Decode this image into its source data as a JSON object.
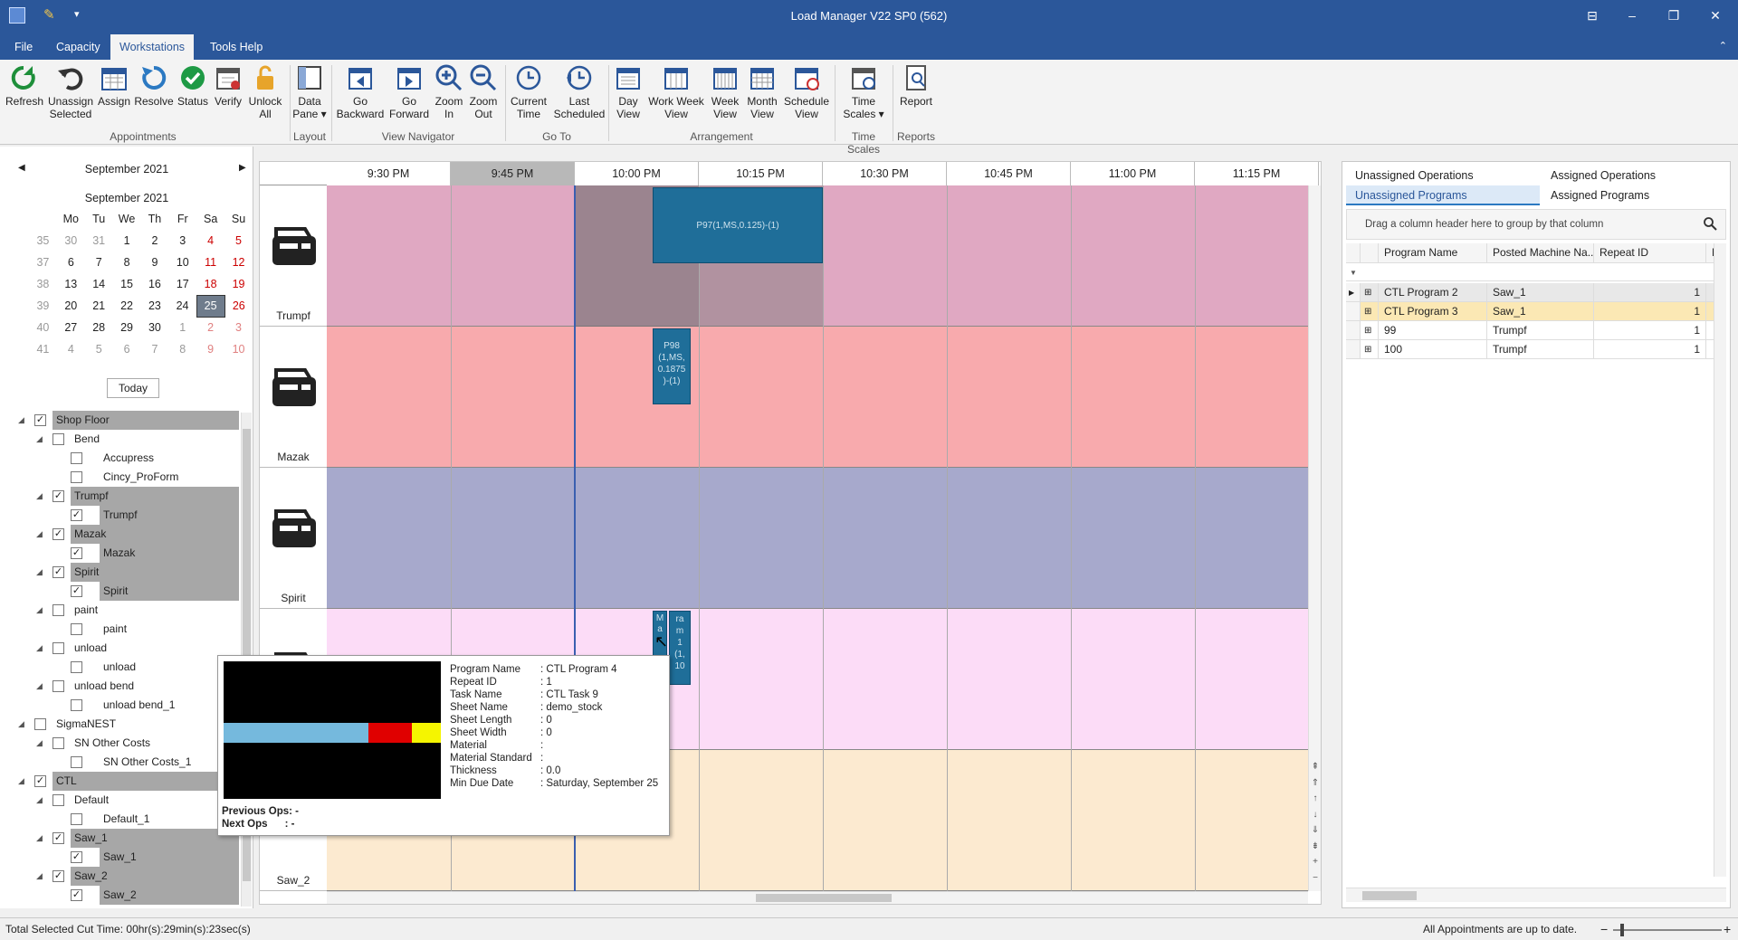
{
  "window": {
    "title": "Load Manager V22 SP0 (562)"
  },
  "menu": {
    "file": "File",
    "capacity": "Capacity",
    "workstations": "Workstations",
    "tools_help": "Tools Help"
  },
  "ribbon": {
    "refresh": "Refresh",
    "unassign": "Unassign",
    "unassign2": "Selected",
    "assign": "Assign",
    "resolve": "Resolve",
    "status": "Status",
    "verify": "Verify",
    "unlock": "Unlock",
    "unlock2": "All",
    "data": "Data",
    "pane": "Pane ▾",
    "go_backward": "Go",
    "go_backward2": "Backward",
    "go_forward": "Go",
    "go_forward2": "Forward",
    "zoom_in": "Zoom",
    "zoom_in2": "In",
    "zoom_out": "Zoom",
    "zoom_out2": "Out",
    "current_time": "Current",
    "current_time2": "Time",
    "last_scheduled": "Last",
    "last_scheduled2": "Scheduled",
    "day_view": "Day",
    "day_view2": "View",
    "work_week": "Work Week",
    "work_week2": "View",
    "week_view": "Week",
    "week_view2": "View",
    "month_view": "Month",
    "month_view2": "View",
    "schedule_view": "Schedule",
    "schedule_view2": "View",
    "time_scales": "Time",
    "time_scales2": "Scales ▾",
    "report": "Report",
    "groups": {
      "appointments": "Appointments",
      "layout": "Layout",
      "view_navigator": "View Navigator",
      "go_to": "Go To",
      "arrangement": "Arrangement",
      "time_scales": "Time Scales",
      "reports": "Reports"
    }
  },
  "calendar": {
    "header": "September 2021",
    "month_title": "September 2021",
    "days": [
      "Mo",
      "Tu",
      "We",
      "Th",
      "Fr",
      "Sa",
      "Su"
    ],
    "weeks": [
      {
        "wk": "35",
        "d": [
          "30",
          "31",
          "1",
          "2",
          "3",
          "4",
          "5"
        ]
      },
      {
        "wk": "37",
        "d": [
          "6",
          "7",
          "8",
          "9",
          "10",
          "11",
          "12"
        ]
      },
      {
        "wk": "38",
        "d": [
          "13",
          "14",
          "15",
          "16",
          "17",
          "18",
          "19"
        ]
      },
      {
        "wk": "39",
        "d": [
          "20",
          "21",
          "22",
          "23",
          "24",
          "25",
          "26"
        ]
      },
      {
        "wk": "40",
        "d": [
          "27",
          "28",
          "29",
          "30",
          "1",
          "2",
          "3"
        ]
      },
      {
        "wk": "41",
        "d": [
          "4",
          "5",
          "6",
          "7",
          "8",
          "9",
          "10"
        ]
      }
    ],
    "today": "Today"
  },
  "tree": [
    {
      "label": "Shop Floor",
      "level": 0,
      "checked": true,
      "hl": true,
      "exp": true
    },
    {
      "label": "Bend",
      "level": 1,
      "checked": false,
      "hl": false,
      "exp": true
    },
    {
      "label": "Accupress",
      "level": 2,
      "checked": false,
      "hl": false
    },
    {
      "label": "Cincy_ProForm",
      "level": 2,
      "checked": false,
      "hl": false
    },
    {
      "label": "Trumpf",
      "level": 1,
      "checked": true,
      "hl": true,
      "exp": true
    },
    {
      "label": "Trumpf",
      "level": 2,
      "checked": true,
      "hl": true
    },
    {
      "label": "Mazak",
      "level": 1,
      "checked": true,
      "hl": true,
      "exp": true
    },
    {
      "label": "Mazak",
      "level": 2,
      "checked": true,
      "hl": true
    },
    {
      "label": "Spirit",
      "level": 1,
      "checked": true,
      "hl": true,
      "exp": true
    },
    {
      "label": "Spirit",
      "level": 2,
      "checked": true,
      "hl": true
    },
    {
      "label": "paint",
      "level": 1,
      "checked": false,
      "hl": false,
      "exp": true
    },
    {
      "label": "paint",
      "level": 2,
      "checked": false,
      "hl": false
    },
    {
      "label": "unload",
      "level": 1,
      "checked": false,
      "hl": false,
      "exp": true
    },
    {
      "label": "unload",
      "level": 2,
      "checked": false,
      "hl": false
    },
    {
      "label": "unload bend",
      "level": 1,
      "checked": false,
      "hl": false,
      "exp": true
    },
    {
      "label": "unload bend_1",
      "level": 2,
      "checked": false,
      "hl": false
    },
    {
      "label": "SigmaNEST",
      "level": 0,
      "checked": false,
      "hl": false,
      "exp": true
    },
    {
      "label": "SN Other Costs",
      "level": 1,
      "checked": false,
      "hl": false,
      "exp": true
    },
    {
      "label": "SN Other Costs_1",
      "level": 2,
      "checked": false,
      "hl": false
    },
    {
      "label": "CTL",
      "level": 0,
      "checked": true,
      "hl": true,
      "exp": true
    },
    {
      "label": "Default",
      "level": 1,
      "checked": false,
      "hl": false,
      "exp": true
    },
    {
      "label": "Default_1",
      "level": 2,
      "checked": false,
      "hl": false
    },
    {
      "label": "Saw_1",
      "level": 1,
      "checked": true,
      "hl": true,
      "exp": true
    },
    {
      "label": "Saw_1",
      "level": 2,
      "checked": true,
      "hl": true
    },
    {
      "label": "Saw_2",
      "level": 1,
      "checked": true,
      "hl": true,
      "exp": true
    },
    {
      "label": "Saw_2",
      "level": 2,
      "checked": true,
      "hl": true
    }
  ],
  "schedule": {
    "times": [
      "9:30 PM",
      "9:45 PM",
      "10:00 PM",
      "10:15 PM",
      "10:30 PM",
      "10:45 PM",
      "11:00 PM",
      "11:15 PM"
    ],
    "resources": [
      "Trumpf",
      "Mazak",
      "Spirit",
      "",
      "Saw_2"
    ],
    "lane_colors": [
      "#e0a8c2",
      "#f8aaad",
      "#a7a9cc",
      "#fcdcf7",
      "#fcead0"
    ],
    "appointments": {
      "p97": "P97(1,MS,0.125)-(1)",
      "p98_lines": [
        "P98",
        "(1,MS,",
        "0.1875",
        ")-(1)"
      ],
      "saw_a": "M a",
      "saw_b_lines": [
        "ra",
        "m",
        "1",
        "(1,",
        "10"
      ]
    }
  },
  "tooltip": {
    "labels": [
      "Program Name",
      "Repeat ID",
      "Task Name",
      "Sheet Name",
      "Sheet Length",
      "Sheet Width",
      "Material",
      "Material Standard",
      "Thickness",
      "Min Due Date"
    ],
    "values": [
      ": CTL Program 4",
      ": 1",
      ": CTL Task 9",
      ": demo_stock",
      ": 0",
      ": 0",
      ":",
      ":",
      ": 0.0",
      ": Saturday, September 25"
    ],
    "prev_ops": "Previous Ops: -",
    "next_ops": "Next Ops      : -"
  },
  "right": {
    "tabs": {
      "unassigned_ops": "Unassigned Operations",
      "assigned_ops": "Assigned Operations",
      "unassigned_programs": "Unassigned Programs",
      "assigned_programs": "Assigned Programs"
    },
    "group_hint": "Drag a column header here to group by that column",
    "columns": [
      "Program Name",
      "Posted Machine Na...",
      "Repeat ID",
      "N"
    ],
    "rows": [
      {
        "name": "CTL Program 2",
        "machine": "Saw_1",
        "repeat": "1"
      },
      {
        "name": "CTL Program 3",
        "machine": "Saw_1",
        "repeat": "1"
      },
      {
        "name": "99",
        "machine": "Trumpf",
        "repeat": "1"
      },
      {
        "name": "100",
        "machine": "Trumpf",
        "repeat": "1"
      }
    ]
  },
  "status": {
    "cut_time": "Total Selected Cut Time:  00hr(s):29min(s):23sec(s)",
    "up_to_date": "All Appointments are up to date."
  }
}
